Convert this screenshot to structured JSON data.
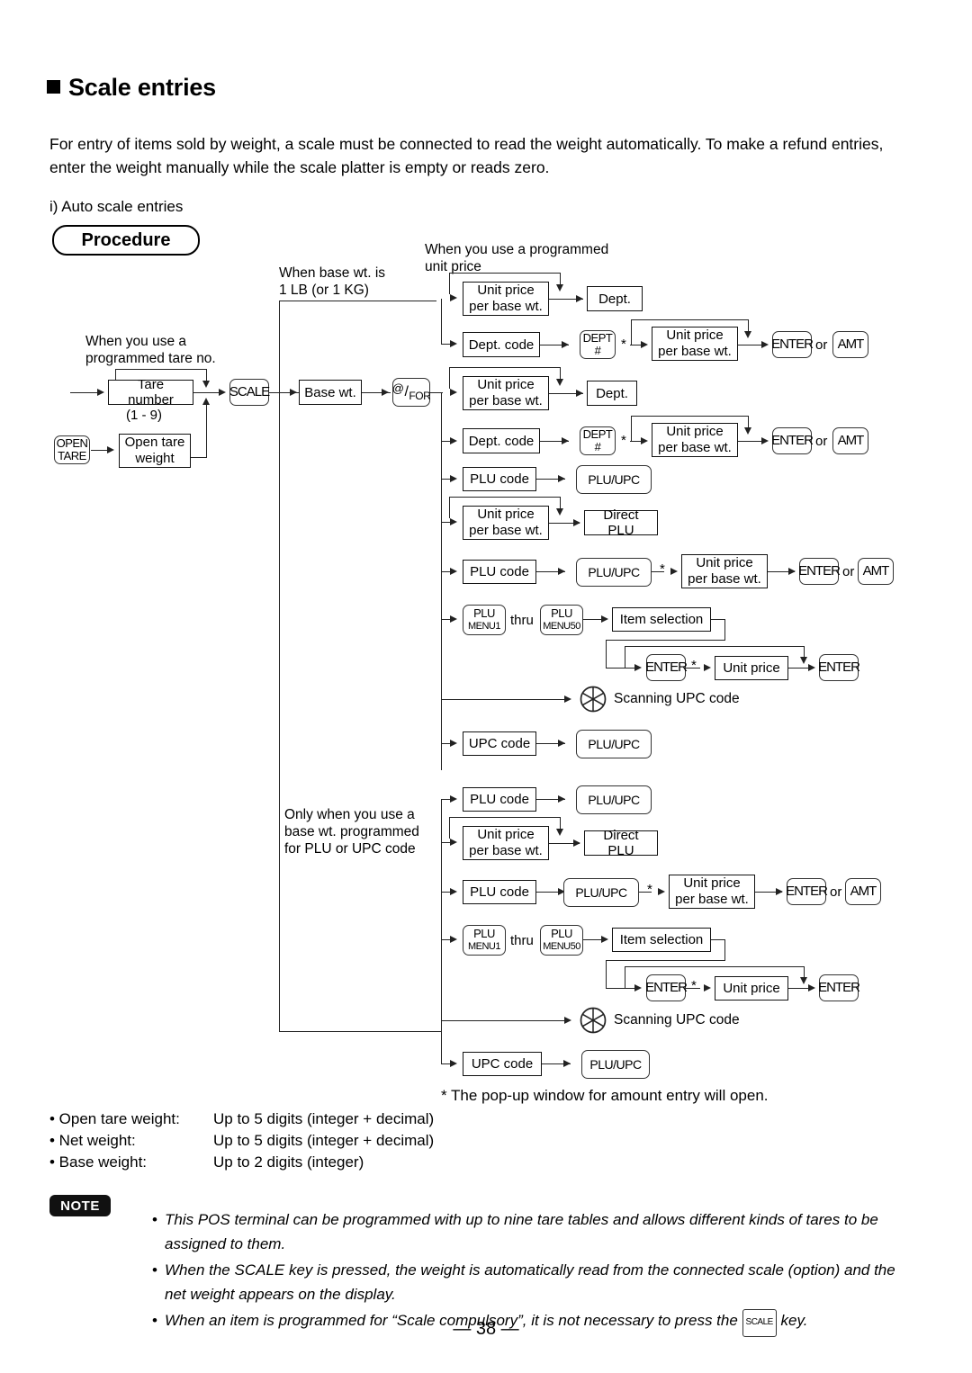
{
  "page": {
    "section_title": "Scale entries",
    "intro": "For entry of items sold by weight, a scale must be connected to read the weight automatically. To make a refund entries, enter the weight manually while the scale platter is empty or reads zero.",
    "subhead": "i) Auto scale entries",
    "procedure_label": "Procedure",
    "page_number": "— 38 —"
  },
  "captions": {
    "programmed_tare": "When you use a\nprogrammed tare no.",
    "base_wt_1lb": "When base wt. is\n1 LB (or 1 KG)",
    "programmed_unit_price": "When you use a programmed\nunit price",
    "only_base_wt": "Only when you use a\nbase wt. programmed\nfor PLU or UPC code",
    "tare_range": "(1 - 9)",
    "thru": "thru",
    "or": "or",
    "asterisk": "*"
  },
  "boxes": {
    "tare_number": "Tare number",
    "open_tare_weight": "Open tare\nweight",
    "base_wt": "Base wt.",
    "unit_price_per_base_wt": "Unit price\nper base wt.",
    "dept": "Dept.",
    "dept_code": "Dept. code",
    "plu_code": "PLU code",
    "direct_plu": "Direct PLU",
    "item_selection": "Item selection",
    "unit_price": "Unit price",
    "upc_code": "UPC code",
    "scanning_upc": "Scanning UPC code"
  },
  "keys": {
    "open_tare": {
      "l1": "OPEN",
      "l2": "TARE"
    },
    "scale": "SCALE",
    "at_for": {
      "l1": "@",
      "l2": "FOR"
    },
    "dept_hash": {
      "l1": "DEPT",
      "l2": "#"
    },
    "enter": "ENTER",
    "amt": "AMT",
    "plu_upc": "PLU/UPC",
    "plu_menu1": {
      "l1": "PLU",
      "l2": "MENU1"
    },
    "plu_menu50": {
      "l1": "PLU",
      "l2": "MENU50"
    },
    "scale_small": "SCALE"
  },
  "footnotes": {
    "popup": "*  The pop-up window for amount entry will open."
  },
  "specs": [
    {
      "label": "• Open tare weight:",
      "value": "Up to 5 digits (integer + decimal)"
    },
    {
      "label": "• Net weight:",
      "value": "Up to 5 digits (integer + decimal)"
    },
    {
      "label": "• Base weight:",
      "value": "Up to 2 digits (integer)"
    }
  ],
  "note": {
    "badge": "NOTE",
    "items": [
      "This POS terminal can be programmed with up to nine tare tables and allows different kinds of tares to be assigned to them.",
      "When the SCALE key is pressed, the weight is automatically read from the connected scale (option) and the net weight appears on the display.",
      "When an item is programmed for “Scale compulsory”, it is not necessary to press the "
    ],
    "item3_tail": " key."
  },
  "colors": {
    "ink": "#000000",
    "line": "#222222",
    "badge_bg": "#111111"
  }
}
